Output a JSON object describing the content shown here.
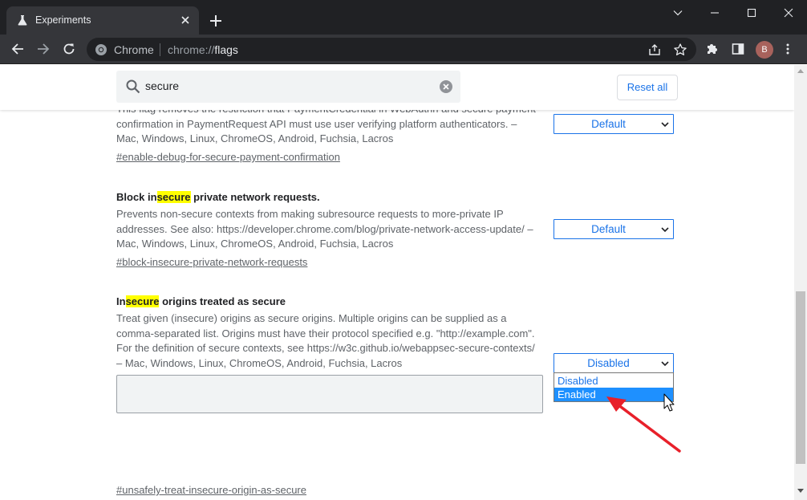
{
  "tab": {
    "title": "Experiments",
    "icon": "flask-icon"
  },
  "omnibox": {
    "site_label": "Chrome",
    "url_prefix": "chrome://",
    "url_host": "flags"
  },
  "profile": {
    "initial": "B",
    "color": "#a8625c"
  },
  "search": {
    "value": "secure"
  },
  "reset_label": "Reset all",
  "experiments": [
    {
      "desc_line1": "This flag removes the restriction that PaymentCredential in WebAuthn and secure payment",
      "desc_line2": "confirmation in PaymentRequest API must use user verifying platform authenticators. –",
      "platforms": "Mac, Windows, Linux, ChromeOS, Android, Fuchsia, Lacros",
      "link": "#enable-debug-for-secure-payment-confirmation",
      "select_value": "Default"
    },
    {
      "title_pre": "Block in",
      "title_hl": "secure",
      "title_post": " private network requests.",
      "desc_line1": "Prevents non-secure contexts from making subresource requests to more-private IP",
      "desc_line2": "addresses. See also: https://developer.chrome.com/blog/private-network-access-update/ –",
      "platforms": "Mac, Windows, Linux, ChromeOS, Android, Fuchsia, Lacros",
      "link": "#block-insecure-private-network-requests",
      "select_value": "Default"
    },
    {
      "title_pre": "In",
      "title_hl": "secure",
      "title_post": " origins treated as secure",
      "desc_line1": "Treat given (insecure) origins as secure origins. Multiple origins can be supplied as a",
      "desc_line2": "comma-separated list. Origins must have their protocol specified e.g. \"http://example.com\".",
      "desc_line3": "For the definition of secure contexts, see https://w3c.github.io/webappsec-secure-contexts/",
      "platforms": "– Mac, Windows, Linux, ChromeOS, Android, Fuchsia, Lacros",
      "link": "#unsafely-treat-insecure-origin-as-secure",
      "select_value": "Disabled",
      "options": [
        "Disabled",
        "Enabled"
      ],
      "highlighted_option": "Enabled"
    }
  ],
  "colors": {
    "accent": "#1a73e8",
    "highlight": "#ffff00",
    "option_selected": "#1e90ff",
    "annotation_arrow": "#e8202a"
  }
}
